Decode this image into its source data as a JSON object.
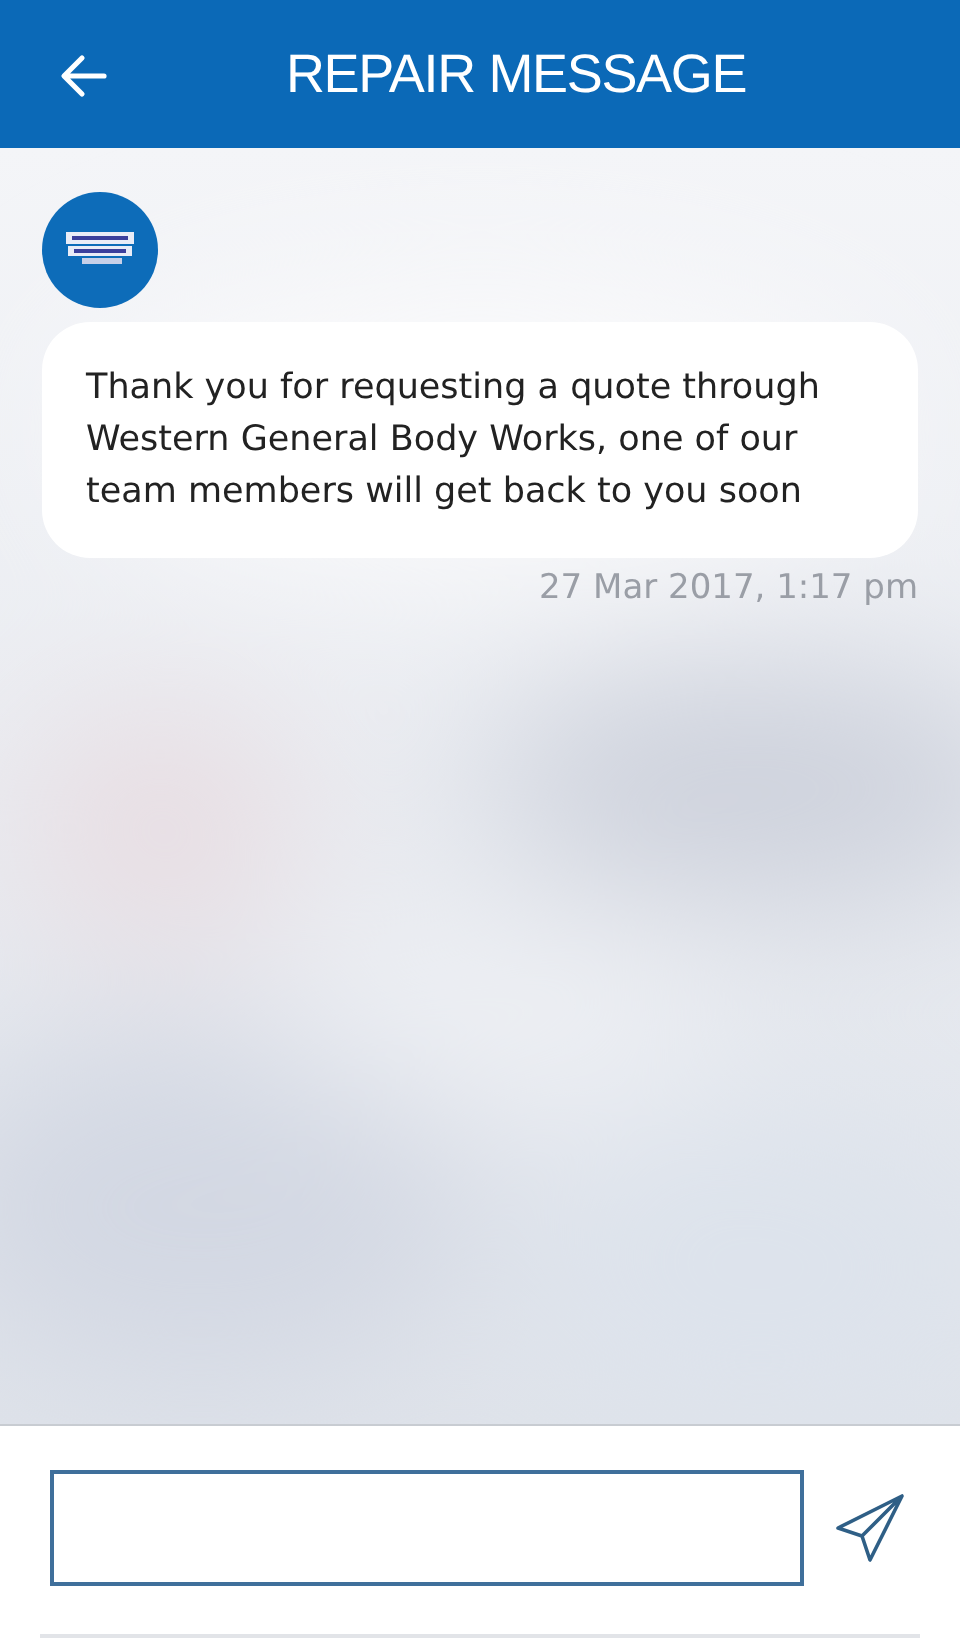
{
  "header": {
    "title": "REPAIR MESSAGE"
  },
  "messages": [
    {
      "text": "Thank you for requesting a quote through Western General Body Works, one of our team members will get back to you soon",
      "time": "27 Mar 2017, 1:17 pm"
    }
  ]
}
